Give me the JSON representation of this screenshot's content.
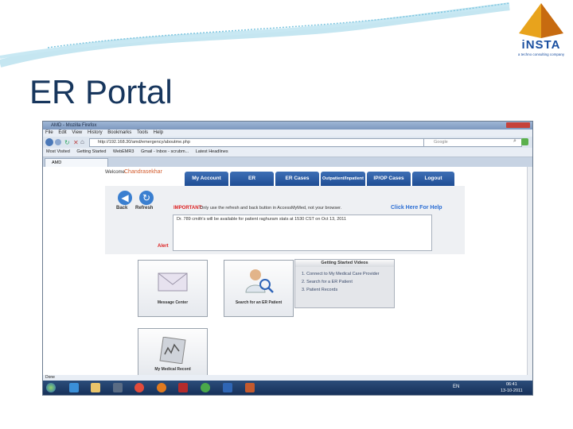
{
  "slide": {
    "title": "ER Portal"
  },
  "logo": {
    "brand": "iNSTA",
    "tagline": "a techno consulting company"
  },
  "browser": {
    "window_title": "AMD - Mozilla Firefox",
    "menu": [
      "File",
      "Edit",
      "View",
      "History",
      "Bookmarks",
      "Tools",
      "Help"
    ],
    "url": "http://192.168.30/amd/emergency/aboutme.php",
    "search_placeholder": "Google",
    "bookmarks": [
      "Most Visited",
      "Getting Started",
      "WebEMR3",
      "Gmail - Inbox - scrubm...",
      "Latest Headlines"
    ],
    "tab_label": "AMD",
    "status": "Done"
  },
  "portal": {
    "welcome_label": "Welcome",
    "user_name": "Chandrasekhar",
    "nav_tabs": [
      "My Account",
      "ER",
      "ER Cases",
      "Outpatient/Inpatient",
      "IP/OP Cases",
      "Logout"
    ],
    "back_label": "Back",
    "refresh_label": "Refresh",
    "important_label": "IMPORTANT:",
    "important_text": "Only use the refresh and back button in AccessMyMed, not your browser.",
    "help_link": "Click Here For Help",
    "message": "Dr. 789 cmith's will be available for patient raghuram stats at 1530 CST on Oct 13, 2011",
    "alert_label": "Alert",
    "tiles": [
      "Message Center",
      "Search for an ER Patient",
      "My Medical Record"
    ],
    "videos_title": "Getting Started Videos",
    "videos": [
      "1. Connect to My Medical Care Provider",
      "2. Search for a ER Patient",
      "3. Patient Records"
    ]
  },
  "taskbar": {
    "lang": "EN",
    "time": "06:41",
    "date": "13-10-2011"
  }
}
